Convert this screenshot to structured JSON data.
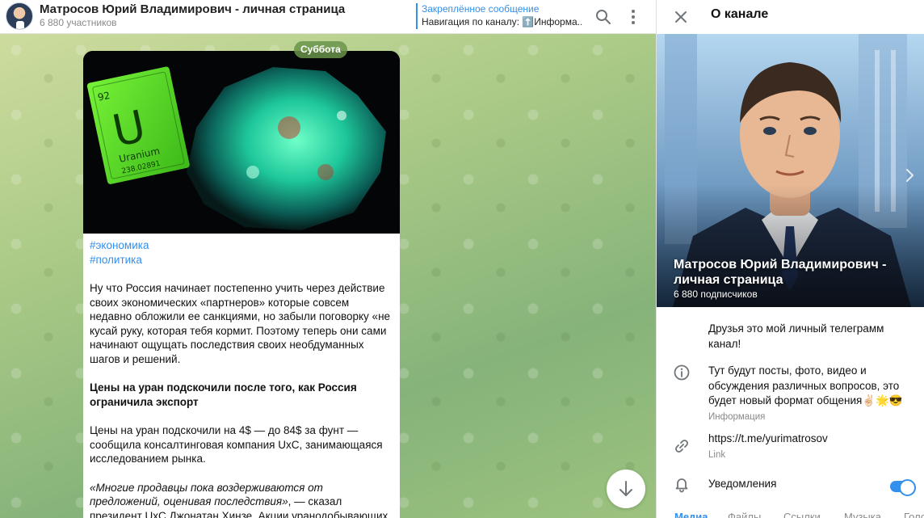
{
  "chat_header": {
    "title": "Матросов Юрий Владимирович - личная страница",
    "members": "6 880 участников",
    "pinned_title": "Закреплённое сообщение",
    "pinned_text": "Навигация по каналу: ⬆️Информа..."
  },
  "date_badge": "Суббота",
  "message": {
    "hashtags": [
      "#экономика",
      "#политика"
    ],
    "p1": "Ну что Россия начинает постепенно учить через действие своих экономических «партнеров» которые совсем недавно обложили ее санкциями, но забыли поговорку «не кусай руку, которая тебя кормит. Поэтому теперь они сами начинают ощущать последствия своих необдуманных шагов и решений.",
    "p2": "Цены на уран подскочили после того, как Россия ограничила экспорт",
    "p3": "Цены на уран подскочили на 4$ — до 84$ за фунт — сообщила консалтинговая компания UxC, занимающаяся исследованием рынка.",
    "p4_quote": "«Многие продавцы пока воздерживаются от предложений, оценивая последствия»",
    "p4_rest": ", — сказал президент UxC Джонатан Хинзе. Акции уранодобывающих",
    "photo": {
      "element_number": "92",
      "element_symbol": "U",
      "element_name": "Uranium",
      "element_mass": "238.02891"
    }
  },
  "info_panel": {
    "title": "О канале",
    "cover_name": "Матросов Юрий Владимирович - личная страница",
    "cover_sub": "6 880 подписчиков",
    "intro": "Друзья это мой личный телеграмм канал!",
    "description": "Тут будут посты, фото, видео и обсуждения различных вопросов, это будет новый формат общения✌🏻🌟😎",
    "description_label": "Информация",
    "link": "https://t.me/yurimatrosov",
    "link_label": "Link",
    "notifications_label": "Уведомления",
    "notifications_on": true,
    "tabs": [
      "Медиа",
      "Файлы",
      "Ссылки",
      "Музыка",
      "Голос"
    ]
  },
  "colors": {
    "accent": "#3390ec",
    "date_badge_bg": "#68944a"
  }
}
